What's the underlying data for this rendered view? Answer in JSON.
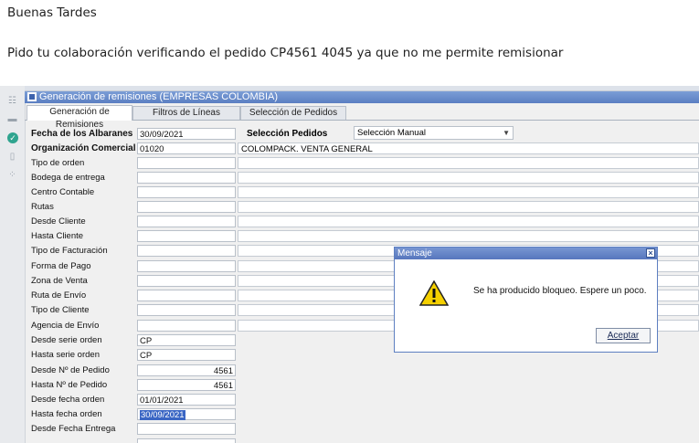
{
  "email": {
    "greeting": "Buenas Tardes",
    "body": "Pido tu colaboración verificando el pedido CP4561 4045 ya que no me permite remisionar"
  },
  "window": {
    "title": "Generación de remisiones (EMPRESAS COLOMBIA)"
  },
  "tabs": [
    {
      "label": "Generación de Remisiones",
      "active": true
    },
    {
      "label": "Filtros de Líneas",
      "active": false
    },
    {
      "label": "Selección de Pedidos",
      "active": false
    }
  ],
  "form": {
    "fecha_albaranes": {
      "label": "Fecha de los Albaranes",
      "value": "30/09/2021"
    },
    "seleccion_pedidos": {
      "label": "Selección Pedidos",
      "value": "Selección Manual"
    },
    "organizacion": {
      "label": "Organización Comercial",
      "value": "01020",
      "description": "COLOMPACK. VENTA GENERAL"
    },
    "fields": [
      {
        "label": "Tipo de orden",
        "value": ""
      },
      {
        "label": "Bodega de entrega",
        "value": ""
      },
      {
        "label": "Centro Contable",
        "value": ""
      },
      {
        "label": "Rutas",
        "value": ""
      },
      {
        "label": "Desde Cliente",
        "value": ""
      },
      {
        "label": "Hasta Cliente",
        "value": ""
      },
      {
        "label": "Tipo de Facturación",
        "value": ""
      },
      {
        "label": "Forma de Pago",
        "value": ""
      },
      {
        "label": "Zona de Venta",
        "value": ""
      },
      {
        "label": "Ruta de Envío",
        "value": ""
      },
      {
        "label": "Tipo de Cliente",
        "value": ""
      },
      {
        "label": "Agencia de Envío",
        "value": ""
      },
      {
        "label": "Desde serie orden",
        "value": "CP"
      },
      {
        "label": "Hasta serie orden",
        "value": "CP"
      },
      {
        "label": "Desde Nº de Pedido",
        "value": "4561"
      },
      {
        "label": "Hasta Nº de Pedido",
        "value": "4561"
      },
      {
        "label": "Desde fecha orden",
        "value": "01/01/2021"
      },
      {
        "label": "Hasta fecha orden",
        "value": "30/09/2021"
      },
      {
        "label": "Desde Fecha Entrega",
        "value": ""
      }
    ]
  },
  "dialog": {
    "title": "Mensaje",
    "close_glyph": "×",
    "message": "Se ha producido bloqueo. Espere un poco.",
    "ok_label": "Aceptar"
  },
  "colors": {
    "titlebar": "#5b7fc2",
    "selection": "#3a66c4",
    "warning": "#f5d000"
  }
}
